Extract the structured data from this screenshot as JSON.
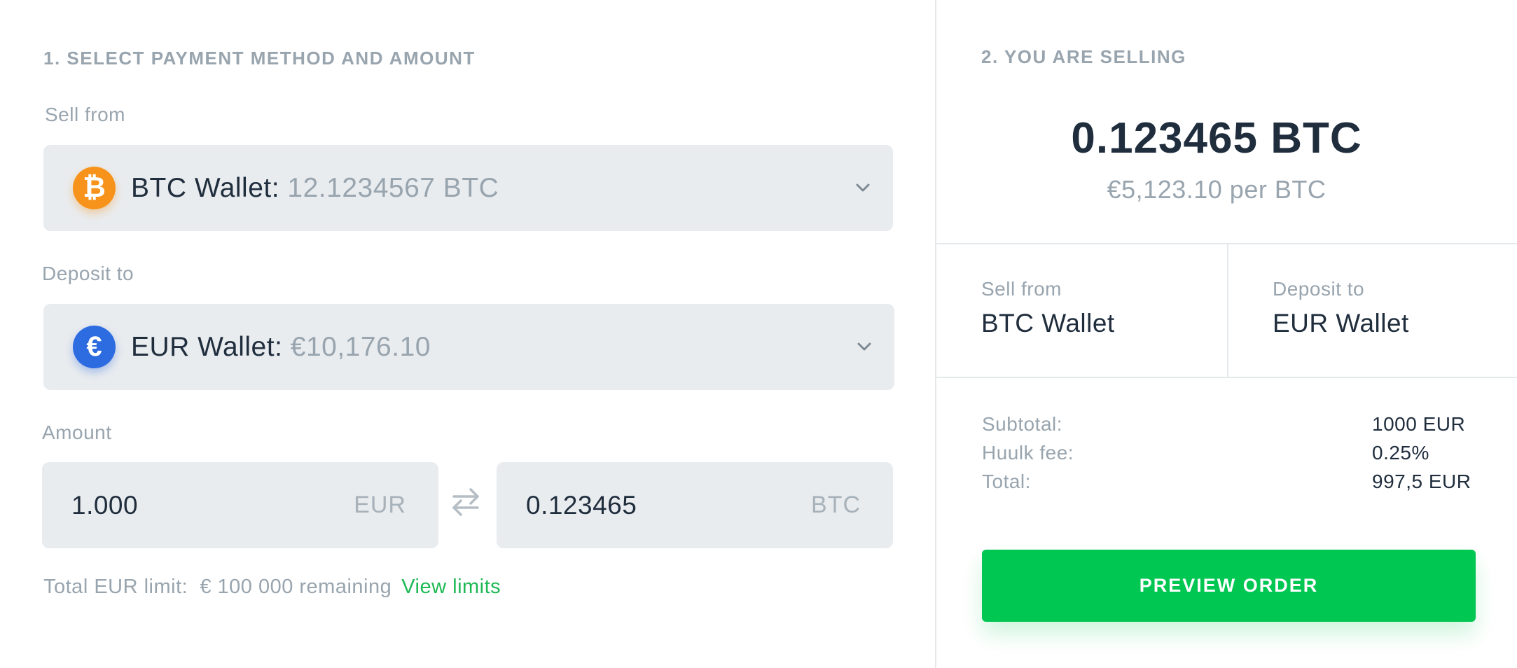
{
  "left": {
    "section_title": "1. SELECT PAYMENT METHOD AND AMOUNT",
    "sell_from": {
      "label": "Sell from",
      "icon": "bitcoin-icon",
      "symbol": "₿",
      "wallet_name": "BTC Wallet:",
      "balance": "12.1234567 BTC"
    },
    "deposit_to": {
      "label": "Deposit to",
      "icon": "euro-icon",
      "symbol": "€",
      "wallet_name": "EUR Wallet:",
      "balance": "€10,176.10"
    },
    "amount": {
      "label": "Amount",
      "fiat_value": "1.000",
      "fiat_currency": "EUR",
      "crypto_value": "0.123465",
      "crypto_currency": "BTC"
    },
    "limit": {
      "text": "Total EUR limit:  € 100 000 remaining",
      "link": "View limits"
    }
  },
  "right": {
    "section_title": "2. YOU ARE SELLING",
    "amount": "0.123465 BTC",
    "rate": "€5,123.10 per BTC",
    "sell_from_label": "Sell from",
    "sell_from_value": "BTC Wallet",
    "deposit_to_label": "Deposit to",
    "deposit_to_value": "EUR Wallet",
    "summary": [
      {
        "label": "Subtotal:",
        "value": "1000 EUR"
      },
      {
        "label": "Huulk fee:",
        "value": "0.25%"
      },
      {
        "label": "Total:",
        "value": "997,5 EUR"
      }
    ],
    "button": "PREVIEW ORDER"
  },
  "colors": {
    "accent_green": "#00c652",
    "btc_orange": "#f7931a",
    "eur_blue": "#2d6be0"
  }
}
